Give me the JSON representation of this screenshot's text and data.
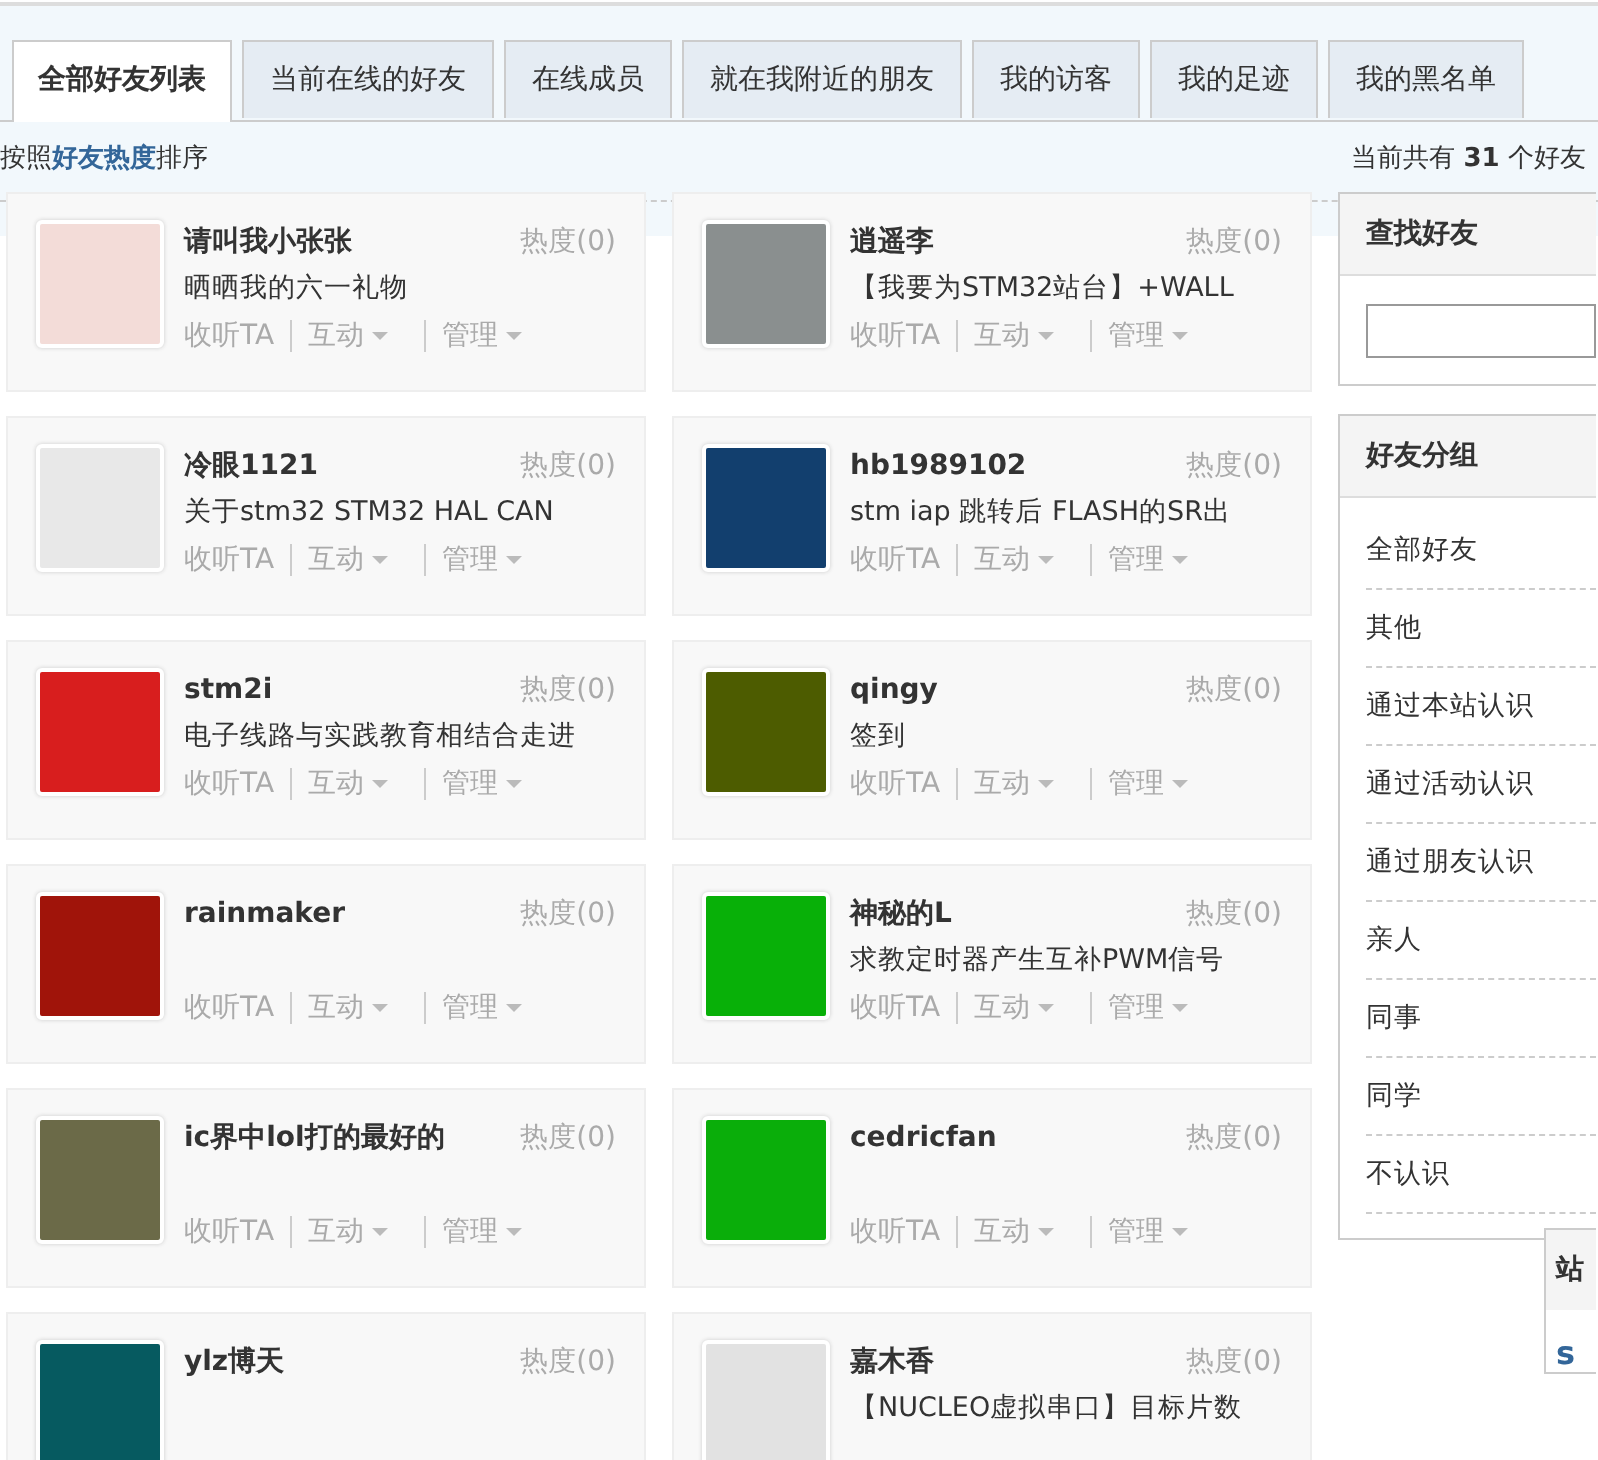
{
  "tabs": [
    {
      "label": "全部好友列表",
      "selected": true
    },
    {
      "label": "当前在线的好友",
      "selected": false
    },
    {
      "label": "在线成员",
      "selected": false
    },
    {
      "label": "就在我附近的朋友",
      "selected": false
    },
    {
      "label": "我的访客",
      "selected": false
    },
    {
      "label": "我的足迹",
      "selected": false
    },
    {
      "label": "我的黑名单",
      "selected": false
    }
  ],
  "sort_note": "按照**好友热度**排序",
  "friend_count": "当前共有 **31** 个好友",
  "friends": [
    {
      "name": "请叫我小张张",
      "heat": "热度(0)",
      "status": "晒晒我的六一礼物",
      "color": "#f3dcd8",
      "actions": [
        {
          "label": "收听TA",
          "dropdown": false
        },
        {
          "label": "互动",
          "dropdown": true
        },
        {
          "label": "管理",
          "dropdown": true
        }
      ]
    },
    {
      "name": "逍遥李",
      "heat": "热度(0)",
      "status": "【我要为STM32站台】+WALL",
      "color": "#8a8f8f",
      "actions": [
        {
          "label": "收听TA",
          "dropdown": false
        },
        {
          "label": "互动",
          "dropdown": true
        },
        {
          "label": "管理",
          "dropdown": true
        }
      ]
    },
    {
      "name": "冷眼1121",
      "heat": "热度(0)",
      "status": "关于stm32 STM32 HAL CAN",
      "color": "#e8e8e8",
      "actions": [
        {
          "label": "收听TA",
          "dropdown": false
        },
        {
          "label": "互动",
          "dropdown": true
        },
        {
          "label": "管理",
          "dropdown": true
        }
      ]
    },
    {
      "name": "hb1989102",
      "heat": "热度(0)",
      "status": "stm iap 跳转后 FLASH的SR出",
      "color": "#123f6e",
      "actions": [
        {
          "label": "收听TA",
          "dropdown": false
        },
        {
          "label": "互动",
          "dropdown": true
        },
        {
          "label": "管理",
          "dropdown": true
        }
      ]
    },
    {
      "name": "stm2i",
      "heat": "热度(0)",
      "status": "电子线路与实践教育相结合走进",
      "color": "#d81e1e",
      "actions": [
        {
          "label": "收听TA",
          "dropdown": false
        },
        {
          "label": "互动",
          "dropdown": true
        },
        {
          "label": "管理",
          "dropdown": true
        }
      ]
    },
    {
      "name": "qingy",
      "heat": "热度(0)",
      "status": "签到",
      "color": "#4d5c00",
      "actions": [
        {
          "label": "收听TA",
          "dropdown": false
        },
        {
          "label": "互动",
          "dropdown": true
        },
        {
          "label": "管理",
          "dropdown": true
        }
      ]
    },
    {
      "name": "rainmaker",
      "heat": "热度(0)",
      "color": "#a0140a",
      "actions": [
        {
          "label": "收听TA",
          "dropdown": false
        },
        {
          "label": "互动",
          "dropdown": true
        },
        {
          "label": "管理",
          "dropdown": true
        }
      ]
    },
    {
      "name": "神秘的L",
      "heat": "热度(0)",
      "status": "求教定时器产生互补PWM信号",
      "color": "#08b008",
      "actions": [
        {
          "label": "收听TA",
          "dropdown": false
        },
        {
          "label": "互动",
          "dropdown": true
        },
        {
          "label": "管理",
          "dropdown": true
        }
      ]
    },
    {
      "name": "ic界中lol打的最好的",
      "heat": "热度(0)",
      "color": "#6b6a48",
      "actions": [
        {
          "label": "收听TA",
          "dropdown": false
        },
        {
          "label": "互动",
          "dropdown": true
        },
        {
          "label": "管理",
          "dropdown": true
        }
      ]
    },
    {
      "name": "cedricfan",
      "heat": "热度(0)",
      "color": "#0aae0a",
      "actions": [
        {
          "label": "收听TA",
          "dropdown": false
        },
        {
          "label": "互动",
          "dropdown": true
        },
        {
          "label": "管理",
          "dropdown": true
        }
      ]
    },
    {
      "name": "ylz博天",
      "heat": "热度(0)",
      "color": "#065a60"
    },
    {
      "name": "嘉木香",
      "heat": "热度(0)",
      "status": "【NUCLEO虚拟串口】目标片数",
      "color": "#e2e2e2"
    }
  ],
  "find_friends": {
    "title": "查找好友"
  },
  "groups": {
    "title": "好友分组",
    "items": [
      "全部好友",
      "其他",
      "通过本站认识",
      "通过活动认识",
      "通过朋友认识",
      "亲人",
      "同事",
      "同学",
      "不认识"
    ]
  },
  "bottom_panel": {
    "title": "站",
    "link": "s"
  }
}
